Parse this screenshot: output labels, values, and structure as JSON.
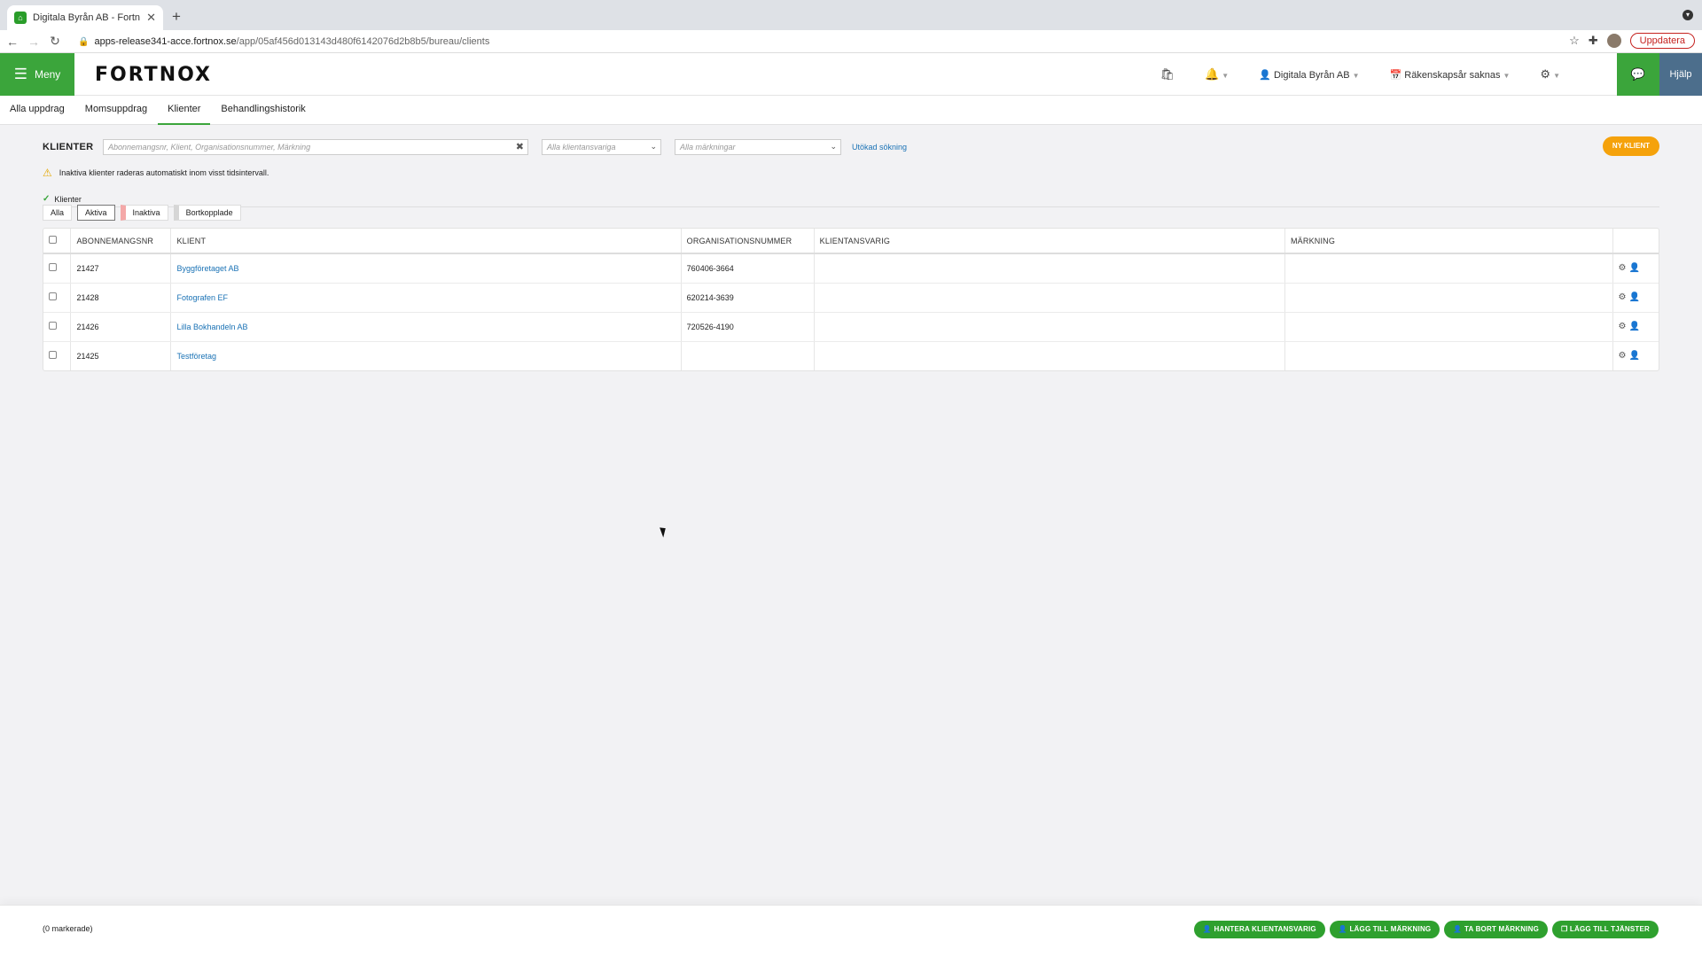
{
  "browser": {
    "tab_title": "Digitala Byrån AB - Fortnox",
    "url_domain": "apps-release341-acce.fortnox.se",
    "url_path": "/app/05af456d013143d480f6142076d2b8b5/bureau/clients",
    "update_label": "Uppdatera"
  },
  "header": {
    "menu_label": "Meny",
    "logo_text": "FORTNOX",
    "company_label": "Digitala Byrån AB",
    "fiscal_year_label": "Räkenskapsår saknas",
    "help_label": "Hjälp"
  },
  "subnav": {
    "tabs": [
      "Alla uppdrag",
      "Momsuppdrag",
      "Klienter",
      "Behandlingshistorik"
    ],
    "active_index": 2
  },
  "clients": {
    "title": "KLIENTER",
    "search_placeholder": "Abonnemangsnr, Klient, Organisationsnummer, Märkning",
    "responsible_select": "Alla klientansvariga",
    "marking_select": "Alla märkningar",
    "advanced_search": "Utökad sökning",
    "new_client": "NY KLIENT",
    "notice": "Inaktiva klienter raderas automatiskt inom visst tidsintervall.",
    "section_label": "Klienter",
    "filters": [
      "Alla",
      "Aktiva",
      "Inaktiva",
      "Bortkopplade"
    ],
    "columns": [
      "ABONNEMANGSNR",
      "KLIENT",
      "ORGANISATIONSNUMMER",
      "KLIENTANSVARIG",
      "MÄRKNING"
    ],
    "rows": [
      {
        "abonnemangsnr": "21427",
        "klient": "Byggföretaget AB",
        "orgnr": "760406-3664",
        "ansvarig": "",
        "markning": ""
      },
      {
        "abonnemangsnr": "21428",
        "klient": "Fotografen EF",
        "orgnr": "620214-3639",
        "ansvarig": "",
        "markning": ""
      },
      {
        "abonnemangsnr": "21426",
        "klient": "Lilla Bokhandeln AB",
        "orgnr": "720526-4190",
        "ansvarig": "",
        "markning": ""
      },
      {
        "abonnemangsnr": "21425",
        "klient": "Testföretag",
        "orgnr": "",
        "ansvarig": "",
        "markning": ""
      }
    ]
  },
  "footer": {
    "marked_count": "(0 markerade)",
    "actions": [
      "HANTERA KLIENTANSVARIG",
      "LÄGG TILL MÄRKNING",
      "TA BORT MÄRKNING",
      "LÄGG TILL TJÄNSTER"
    ]
  },
  "colors": {
    "brand_green": "#3ba53b",
    "help_blue": "#4c6e8c",
    "new_client_orange": "#f5a20b",
    "link_blue": "#1a72b5"
  }
}
